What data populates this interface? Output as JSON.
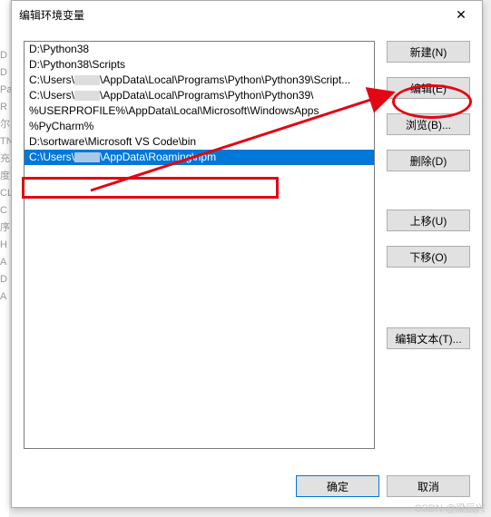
{
  "bg_letters": "D\nD\nPa\nR\n尔\nTN\n充\n度\nCL\nC\n序\nH\nA\nD\nA",
  "dialog": {
    "title": "编辑环境变量",
    "close_icon": "✕"
  },
  "list": {
    "items": [
      "D:\\Python38",
      "D:\\Python38\\Scripts",
      "C:\\Users\\████\\AppData\\Local\\Programs\\Python\\Python39\\Script...",
      "C:\\Users\\████\\AppData\\Local\\Programs\\Python\\Python39\\",
      "%USERPROFILE%\\AppData\\Local\\Microsoft\\WindowsApps",
      "%PyCharm%",
      "D:\\sortware\\Microsoft VS Code\\bin",
      "C:\\Users\\████\\AppData\\Roaming\\npm"
    ],
    "selected_index": 7
  },
  "buttons": {
    "new": "新建(N)",
    "edit": "编辑(E)",
    "browse": "浏览(B)...",
    "delete": "删除(D)",
    "move_up": "上移(U)",
    "move_down": "下移(O)",
    "edit_text": "编辑文本(T)...",
    "ok": "确定",
    "cancel": "取消"
  },
  "watermark": "CSDN @梁辰兴"
}
